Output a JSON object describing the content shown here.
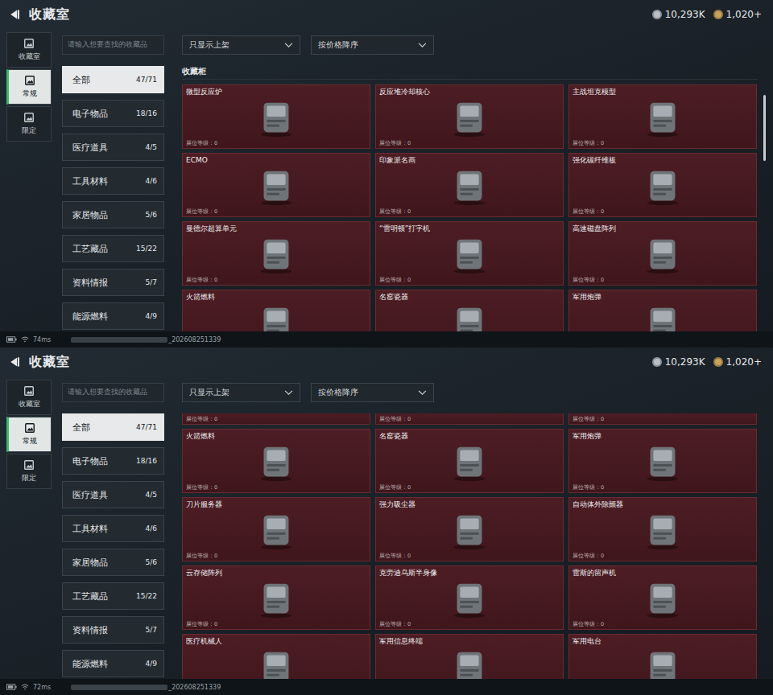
{
  "panels": [
    {
      "header": {
        "title": "收藏室",
        "currencies": [
          {
            "amount": "10,293K",
            "color": "#b9c0c6"
          },
          {
            "amount": "1,020+",
            "color": "#c9a35a"
          }
        ]
      },
      "nav": [
        {
          "label": "收藏室",
          "selected": false
        },
        {
          "label": "常规",
          "selected": true
        },
        {
          "label": "限定",
          "selected": false
        }
      ],
      "search": {
        "placeholder": "请输入想要查找的收藏品"
      },
      "categories": [
        {
          "name": "全部",
          "count": "47/71",
          "selected": true
        },
        {
          "name": "电子物品",
          "count": "18/16",
          "selected": false
        },
        {
          "name": "医疗道具",
          "count": "4/5",
          "selected": false
        },
        {
          "name": "工具材料",
          "count": "4/6",
          "selected": false
        },
        {
          "name": "家居物品",
          "count": "5/6",
          "selected": false
        },
        {
          "name": "工艺藏品",
          "count": "15/22",
          "selected": false
        },
        {
          "name": "资料情报",
          "count": "5/7",
          "selected": false
        },
        {
          "name": "能源燃料",
          "count": "4/9",
          "selected": false
        }
      ],
      "filters": [
        {
          "label": "只显示上架"
        },
        {
          "label": "按价格降序"
        }
      ],
      "section_title": "收藏柜",
      "scrollbar": {
        "level": 0.28
      },
      "items": [
        {
          "kind": "card",
          "name": "微型反应炉",
          "level": "展位等级：0"
        },
        {
          "kind": "card",
          "name": "反应堆冷却核心",
          "level": "展位等级：0"
        },
        {
          "kind": "card",
          "name": "主战坦克模型",
          "level": "展位等级：0"
        },
        {
          "kind": "card",
          "name": "ECMO",
          "level": "展位等级：0"
        },
        {
          "kind": "card",
          "name": "印象派名画",
          "level": "展位等级：0"
        },
        {
          "kind": "card",
          "name": "强化碳纤维板",
          "level": "展位等级：0"
        },
        {
          "kind": "card",
          "name": "曼德尔超算单元",
          "level": "展位等级：0"
        },
        {
          "kind": "card",
          "name": "“雷明顿”打字机",
          "level": "展位等级：0"
        },
        {
          "kind": "card",
          "name": "高速磁盘阵列",
          "level": "展位等级：0"
        },
        {
          "kind": "card",
          "name": "火箭燃料"
        },
        {
          "kind": "card",
          "name": "名窑瓷器"
        },
        {
          "kind": "card",
          "name": "军用炮弹"
        }
      ],
      "status_bar": {
        "ping": "74ms",
        "build": "_202608251339"
      }
    },
    {
      "header": {
        "title": "收藏室",
        "currencies": [
          {
            "amount": "10,293K",
            "color": "#b9c0c6"
          },
          {
            "amount": "1,020+",
            "color": "#c9a35a"
          }
        ]
      },
      "nav": [
        {
          "label": "收藏室",
          "selected": false
        },
        {
          "label": "常规",
          "selected": true
        },
        {
          "label": "限定",
          "selected": false
        }
      ],
      "search": {
        "placeholder": "请输入想要查找的收藏品"
      },
      "categories": [
        {
          "name": "全部",
          "count": "47/71",
          "selected": true
        },
        {
          "name": "电子物品",
          "count": "18/16",
          "selected": false
        },
        {
          "name": "医疗道具",
          "count": "4/5",
          "selected": false
        },
        {
          "name": "工具材料",
          "count": "4/6",
          "selected": false
        },
        {
          "name": "家居物品",
          "count": "5/6",
          "selected": false
        },
        {
          "name": "工艺藏品",
          "count": "15/22",
          "selected": false
        },
        {
          "name": "资料情报",
          "count": "5/7",
          "selected": false
        },
        {
          "name": "能源燃料",
          "count": "4/9",
          "selected": false
        }
      ],
      "filters": [
        {
          "label": "只显示上架"
        },
        {
          "label": "按价格降序"
        }
      ],
      "items": [
        {
          "kind": "partial",
          "level": "展位等级：0"
        },
        {
          "kind": "partial",
          "level": "展位等级：0"
        },
        {
          "kind": "partial",
          "level": "展位等级：0"
        },
        {
          "kind": "card",
          "name": "火箭燃料",
          "level": "展位等级：0"
        },
        {
          "kind": "card",
          "name": "名窑瓷器",
          "level": "展位等级：0"
        },
        {
          "kind": "card",
          "name": "军用炮弹",
          "level": "展位等级：0"
        },
        {
          "kind": "card",
          "name": "刀片服务器",
          "level": "展位等级：0"
        },
        {
          "kind": "card",
          "name": "强力吸尘器",
          "level": "展位等级：0"
        },
        {
          "kind": "card",
          "name": "自动体外除颤器",
          "level": "展位等级：0"
        },
        {
          "kind": "card",
          "name": "云存储阵列",
          "level": "展位等级：0"
        },
        {
          "kind": "card",
          "name": "克劳迪乌斯半身像",
          "level": "展位等级：0"
        },
        {
          "kind": "card",
          "name": "雷斯的留声机",
          "level": "展位等级：0"
        },
        {
          "kind": "card",
          "name": "医疗机械人"
        },
        {
          "kind": "card",
          "name": "军用信息终端"
        },
        {
          "kind": "card",
          "name": "军用电台"
        }
      ],
      "status_bar": {
        "ping": "72ms",
        "build": "_202608251339"
      }
    }
  ]
}
